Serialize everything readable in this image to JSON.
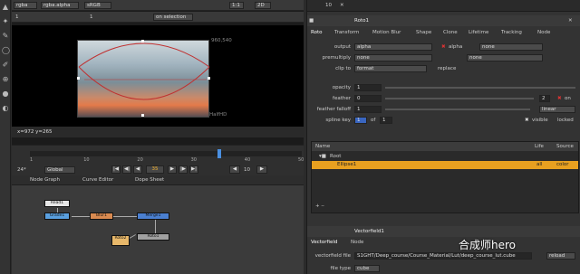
{
  "viewer": {
    "channels": "rgba",
    "layer": "rgba.alpha",
    "colorspace": "sRGB",
    "zoom_ratio": "1:1",
    "view_mode": "2D",
    "frame_num": "1",
    "gain_label": "1",
    "on_selection": "on selection",
    "res_label": "960,540",
    "format_label": "HalfHD",
    "coords": "x=972 y=265"
  },
  "timeline": {
    "ticks": [
      "1",
      "10",
      "20",
      "30",
      "40",
      "50"
    ],
    "current_frame": "35",
    "fps": "24*",
    "global": "Global",
    "step": "10",
    "playhead_fraction": 0.7
  },
  "nodegraph": {
    "tabs": [
      "Node Graph",
      "Curve Editor",
      "Dope Sheet"
    ],
    "nodes": [
      {
        "label": "Read1",
        "color": "#e6e6e6"
      },
      {
        "label": "Grade1",
        "color": "#5aa0e0"
      },
      {
        "label": "Blur1",
        "color": "#d98a50"
      },
      {
        "label": "Merge1",
        "color": "#4a7fd0"
      },
      {
        "label": "Roto1",
        "color": "#a0a0a0"
      },
      {
        "label": "Roto2",
        "color": "#e8b86a"
      }
    ]
  },
  "props": {
    "top_counter": "10",
    "roto_title": "Roto1",
    "tabs": [
      "Roto",
      "Transform",
      "Motion Blur",
      "Shape",
      "Clone",
      "Lifetime",
      "Tracking",
      "Node"
    ],
    "output_label": "output",
    "output_value": "alpha",
    "alpha_label": "alpha",
    "output_none": "none",
    "premultiply_label": "premultiply",
    "premultiply_value": "none",
    "premultiply_none": "none",
    "clipto_label": "clip to",
    "clipto_value": "format",
    "replace_label": "replace",
    "opacity_label": "opacity",
    "opacity_value": "1",
    "feather_label": "feather",
    "feather_value": "0",
    "feather_num": "2",
    "on_label": "on",
    "falloff_label": "feather falloff",
    "falloff_value": "1",
    "falloff_type": "linear",
    "splinekey_label": "spline key",
    "splinekey_value": "1",
    "of_label": "of",
    "of_value": "1",
    "visible_label": "visible",
    "locked_label": "locked",
    "tree_cols": [
      "Name",
      "Life",
      "Source"
    ],
    "tree_root": "Root",
    "tree_item": "Ellipse1",
    "tree_item_life": "all",
    "tree_item_source": "color",
    "vf_title": "Vectorfield1",
    "vf_tabs": [
      "Vectorfield",
      "Node"
    ],
    "vf_file_label": "vectorfield file",
    "vf_file_value": "S1GHT/Deep_course/Course_Material/Lut/deep_course_lut.cube",
    "reload_label": "reload",
    "filetype_label": "file type",
    "filetype_value": "cube",
    "watermark": "合成师hero"
  },
  "colors": {
    "accent": "#e8a020",
    "playhead": "#4a8fe0",
    "selection": "#e8a020"
  }
}
